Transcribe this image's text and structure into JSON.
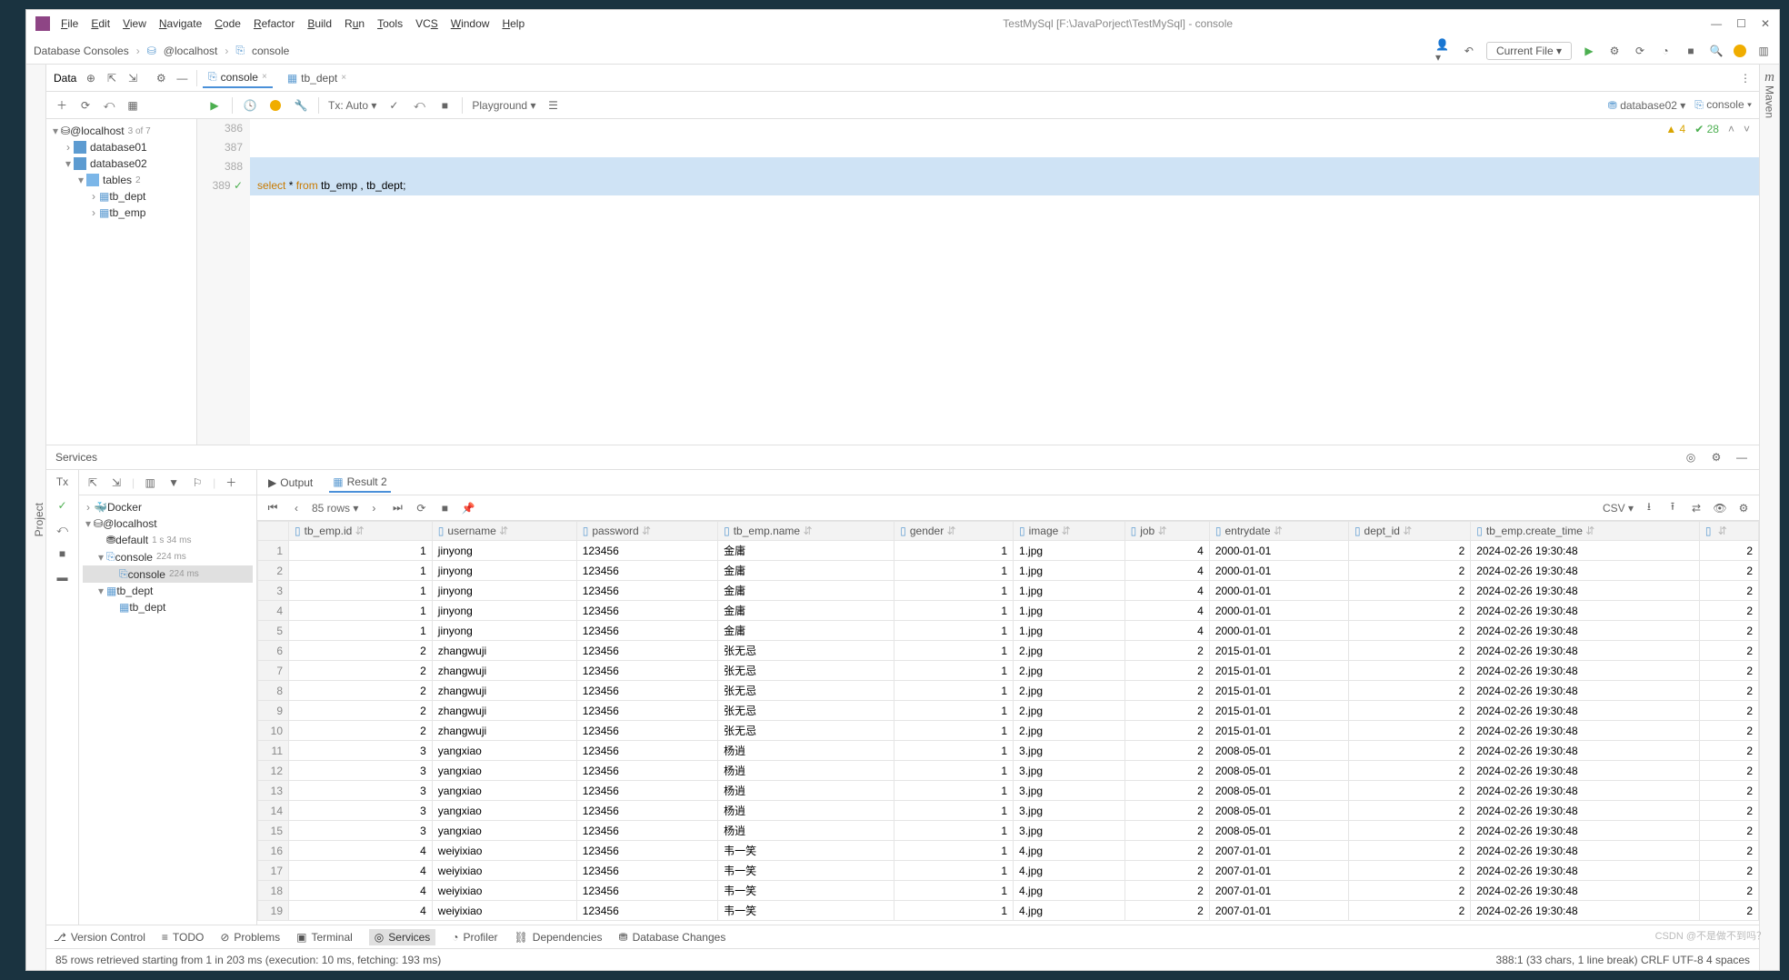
{
  "title": "TestMySql [F:\\JavaPorject\\TestMySql] - console",
  "menu": [
    "File",
    "Edit",
    "View",
    "Navigate",
    "Code",
    "Refactor",
    "Build",
    "Run",
    "Tools",
    "VCS",
    "Window",
    "Help"
  ],
  "breadcrumb": {
    "a": "Database Consoles",
    "b": "@localhost",
    "c": "console"
  },
  "currentFile": "Current File",
  "dataTool": "Data",
  "txMode": "Tx: Auto",
  "playground": "Playground",
  "schema": "database02",
  "consoleSel": "console",
  "dbTree": {
    "root": "@localhost",
    "root_info": "3 of 7",
    "db1": "database01",
    "db2": "database02",
    "tables": "tables",
    "tables_cnt": "2",
    "t1": "tb_dept",
    "t2": "tb_emp"
  },
  "tabs": {
    "t1": "console",
    "t2": "tb_dept"
  },
  "code": {
    "l1": "386",
    "l2": "387",
    "l3": "388",
    "l4": "389",
    "sql_kw1": "select",
    "sql_kw2": "from",
    "sql_rest": " *  ",
    "sql_tables": " tb_emp , tb_dept;"
  },
  "editorStatus": {
    "warn": "4",
    "check": "28"
  },
  "servicesTitle": "Services",
  "svcTree": {
    "docker": "Docker",
    "localhost": "@localhost",
    "default": "default",
    "default_t": "1 s 34 ms",
    "console": "console",
    "console_t": "224 ms",
    "console2": "console",
    "console2_t": "224 ms",
    "tbdept": "tb_dept",
    "tbdept2": "tb_dept"
  },
  "resultTabs": {
    "output": "Output",
    "result": "Result 2"
  },
  "resultBar": {
    "rows": "85 rows",
    "csv": "CSV"
  },
  "columns": [
    "tb_emp.id",
    "username",
    "password",
    "tb_emp.name",
    "gender",
    "image",
    "job",
    "entrydate",
    "dept_id",
    "tb_emp.create_time",
    ""
  ],
  "rows": [
    {
      "n": 1,
      "id": 1,
      "u": "jinyong",
      "p": "123456",
      "name": "金庸",
      "g": 1,
      "img": "1.jpg",
      "job": 4,
      "ed": "2000-01-01",
      "d": 2,
      "ct": "2024-02-26 19:30:48",
      "x": 2
    },
    {
      "n": 2,
      "id": 1,
      "u": "jinyong",
      "p": "123456",
      "name": "金庸",
      "g": 1,
      "img": "1.jpg",
      "job": 4,
      "ed": "2000-01-01",
      "d": 2,
      "ct": "2024-02-26 19:30:48",
      "x": 2
    },
    {
      "n": 3,
      "id": 1,
      "u": "jinyong",
      "p": "123456",
      "name": "金庸",
      "g": 1,
      "img": "1.jpg",
      "job": 4,
      "ed": "2000-01-01",
      "d": 2,
      "ct": "2024-02-26 19:30:48",
      "x": 2
    },
    {
      "n": 4,
      "id": 1,
      "u": "jinyong",
      "p": "123456",
      "name": "金庸",
      "g": 1,
      "img": "1.jpg",
      "job": 4,
      "ed": "2000-01-01",
      "d": 2,
      "ct": "2024-02-26 19:30:48",
      "x": 2
    },
    {
      "n": 5,
      "id": 1,
      "u": "jinyong",
      "p": "123456",
      "name": "金庸",
      "g": 1,
      "img": "1.jpg",
      "job": 4,
      "ed": "2000-01-01",
      "d": 2,
      "ct": "2024-02-26 19:30:48",
      "x": 2
    },
    {
      "n": 6,
      "id": 2,
      "u": "zhangwuji",
      "p": "123456",
      "name": "张无忌",
      "g": 1,
      "img": "2.jpg",
      "job": 2,
      "ed": "2015-01-01",
      "d": 2,
      "ct": "2024-02-26 19:30:48",
      "x": 2
    },
    {
      "n": 7,
      "id": 2,
      "u": "zhangwuji",
      "p": "123456",
      "name": "张无忌",
      "g": 1,
      "img": "2.jpg",
      "job": 2,
      "ed": "2015-01-01",
      "d": 2,
      "ct": "2024-02-26 19:30:48",
      "x": 2
    },
    {
      "n": 8,
      "id": 2,
      "u": "zhangwuji",
      "p": "123456",
      "name": "张无忌",
      "g": 1,
      "img": "2.jpg",
      "job": 2,
      "ed": "2015-01-01",
      "d": 2,
      "ct": "2024-02-26 19:30:48",
      "x": 2
    },
    {
      "n": 9,
      "id": 2,
      "u": "zhangwuji",
      "p": "123456",
      "name": "张无忌",
      "g": 1,
      "img": "2.jpg",
      "job": 2,
      "ed": "2015-01-01",
      "d": 2,
      "ct": "2024-02-26 19:30:48",
      "x": 2
    },
    {
      "n": 10,
      "id": 2,
      "u": "zhangwuji",
      "p": "123456",
      "name": "张无忌",
      "g": 1,
      "img": "2.jpg",
      "job": 2,
      "ed": "2015-01-01",
      "d": 2,
      "ct": "2024-02-26 19:30:48",
      "x": 2
    },
    {
      "n": 11,
      "id": 3,
      "u": "yangxiao",
      "p": "123456",
      "name": "杨逍",
      "g": 1,
      "img": "3.jpg",
      "job": 2,
      "ed": "2008-05-01",
      "d": 2,
      "ct": "2024-02-26 19:30:48",
      "x": 2
    },
    {
      "n": 12,
      "id": 3,
      "u": "yangxiao",
      "p": "123456",
      "name": "杨逍",
      "g": 1,
      "img": "3.jpg",
      "job": 2,
      "ed": "2008-05-01",
      "d": 2,
      "ct": "2024-02-26 19:30:48",
      "x": 2
    },
    {
      "n": 13,
      "id": 3,
      "u": "yangxiao",
      "p": "123456",
      "name": "杨逍",
      "g": 1,
      "img": "3.jpg",
      "job": 2,
      "ed": "2008-05-01",
      "d": 2,
      "ct": "2024-02-26 19:30:48",
      "x": 2
    },
    {
      "n": 14,
      "id": 3,
      "u": "yangxiao",
      "p": "123456",
      "name": "杨逍",
      "g": 1,
      "img": "3.jpg",
      "job": 2,
      "ed": "2008-05-01",
      "d": 2,
      "ct": "2024-02-26 19:30:48",
      "x": 2
    },
    {
      "n": 15,
      "id": 3,
      "u": "yangxiao",
      "p": "123456",
      "name": "杨逍",
      "g": 1,
      "img": "3.jpg",
      "job": 2,
      "ed": "2008-05-01",
      "d": 2,
      "ct": "2024-02-26 19:30:48",
      "x": 2
    },
    {
      "n": 16,
      "id": 4,
      "u": "weiyixiao",
      "p": "123456",
      "name": "韦一笑",
      "g": 1,
      "img": "4.jpg",
      "job": 2,
      "ed": "2007-01-01",
      "d": 2,
      "ct": "2024-02-26 19:30:48",
      "x": 2
    },
    {
      "n": 17,
      "id": 4,
      "u": "weiyixiao",
      "p": "123456",
      "name": "韦一笑",
      "g": 1,
      "img": "4.jpg",
      "job": 2,
      "ed": "2007-01-01",
      "d": 2,
      "ct": "2024-02-26 19:30:48",
      "x": 2
    },
    {
      "n": 18,
      "id": 4,
      "u": "weiyixiao",
      "p": "123456",
      "name": "韦一笑",
      "g": 1,
      "img": "4.jpg",
      "job": 2,
      "ed": "2007-01-01",
      "d": 2,
      "ct": "2024-02-26 19:30:48",
      "x": 2
    },
    {
      "n": 19,
      "id": 4,
      "u": "weiyixiao",
      "p": "123456",
      "name": "韦一笑",
      "g": 1,
      "img": "4.jpg",
      "job": 2,
      "ed": "2007-01-01",
      "d": 2,
      "ct": "2024-02-26 19:30:48",
      "x": 2
    }
  ],
  "bottom": {
    "vc": "Version Control",
    "todo": "TODO",
    "problems": "Problems",
    "terminal": "Terminal",
    "services": "Services",
    "profiler": "Profiler",
    "deps": "Dependencies",
    "dbchanges": "Database Changes"
  },
  "status": {
    "left": "85 rows retrieved starting from 1 in 203 ms (execution: 10 ms, fetching: 193 ms)",
    "right": "388:1 (33 chars, 1 line break)   CRLF   UTF-8   4 spaces"
  },
  "watermark": "CSDN @不是做不到吗？"
}
